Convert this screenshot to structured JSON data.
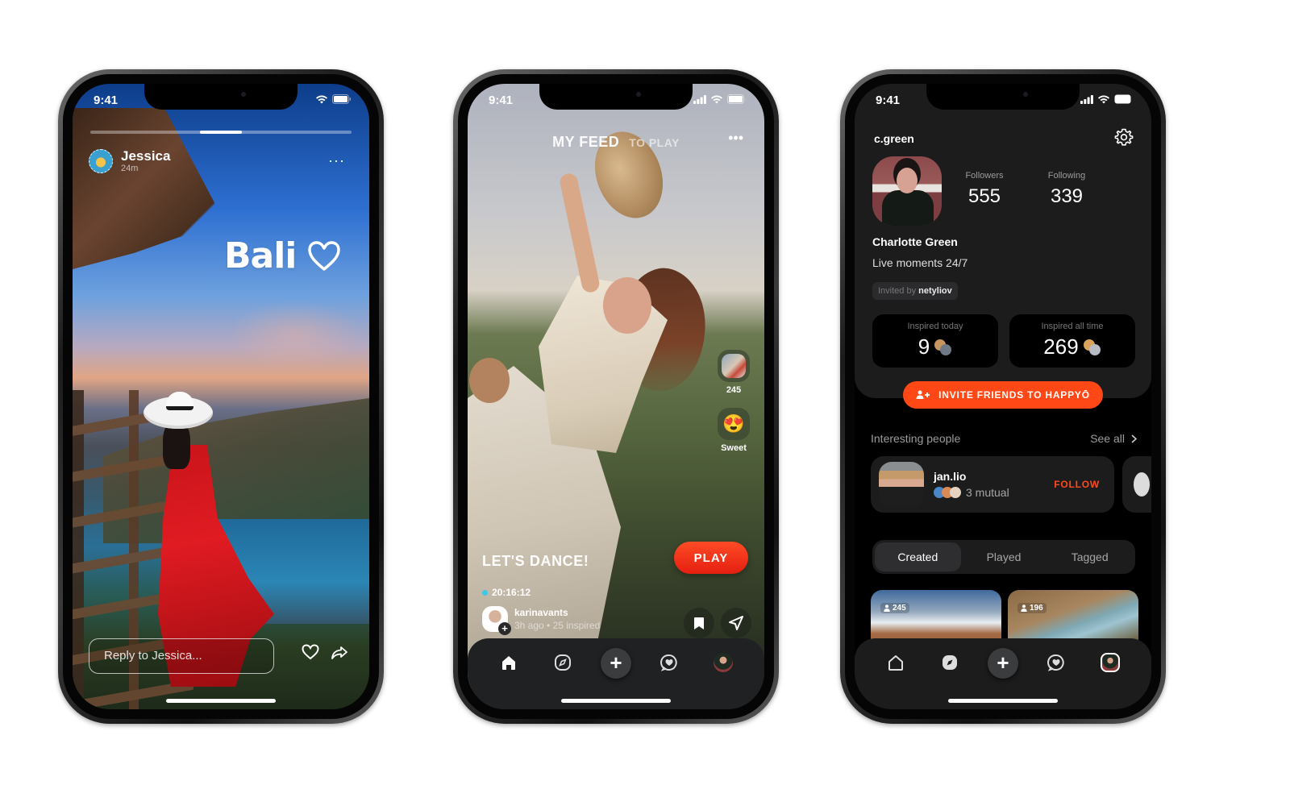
{
  "status_bar": {
    "time": "9:41"
  },
  "story": {
    "user_name": "Jessica",
    "posted_ago": "24m",
    "progress_segments": 3,
    "active_segment": 2,
    "caption": "Bali",
    "caption_icon": "heart-outline-icon",
    "reply_placeholder": "Reply to Jessica...",
    "actions": [
      "heart-icon",
      "share-icon"
    ]
  },
  "feed": {
    "tabs": [
      {
        "label": "MY FEED",
        "active": true
      },
      {
        "label": "TO PLAY",
        "active": false
      }
    ],
    "more_label": "•••",
    "side_actions": [
      {
        "type": "thumbnail",
        "label": "245"
      },
      {
        "type": "emoji",
        "emoji": "😍",
        "label": "Sweet"
      }
    ],
    "post_title": "LET'S DANCE!",
    "play_label": "PLAY",
    "timer": "20:16:12",
    "author": {
      "name": "karinavants",
      "meta": "3h ago • 25 inspired"
    },
    "accent_color": "#ff3b1f"
  },
  "tabbar": {
    "items": [
      "home-icon",
      "explore-compass-icon",
      "create-plus-icon",
      "activity-heart-icon",
      "profile-avatar"
    ]
  },
  "profile": {
    "username": "c.green",
    "followers_label": "Followers",
    "followers": "555",
    "following_label": "Following",
    "following": "339",
    "full_name": "Charlotte Green",
    "bio": "Live moments 24/7",
    "invited_prefix": "Invited by",
    "invited_by": "netyliov",
    "inspired_today_label": "Inspired today",
    "inspired_today": "9",
    "inspired_all_label": "Inspired all time",
    "inspired_all": "269",
    "invite_button": "INVITE FRIENDS TO HAPPYŌ",
    "section_title": "Interesting people",
    "see_all": "See all",
    "people": [
      {
        "name": "jan.lio",
        "mutual": "3 mutual",
        "action": "FOLLOW"
      }
    ],
    "tabs": [
      {
        "label": "Created",
        "active": true
      },
      {
        "label": "Played",
        "active": false
      },
      {
        "label": "Tagged",
        "active": false
      }
    ],
    "posts": [
      {
        "count": "245"
      },
      {
        "count": "196"
      }
    ],
    "accent_color": "#ff4815"
  }
}
